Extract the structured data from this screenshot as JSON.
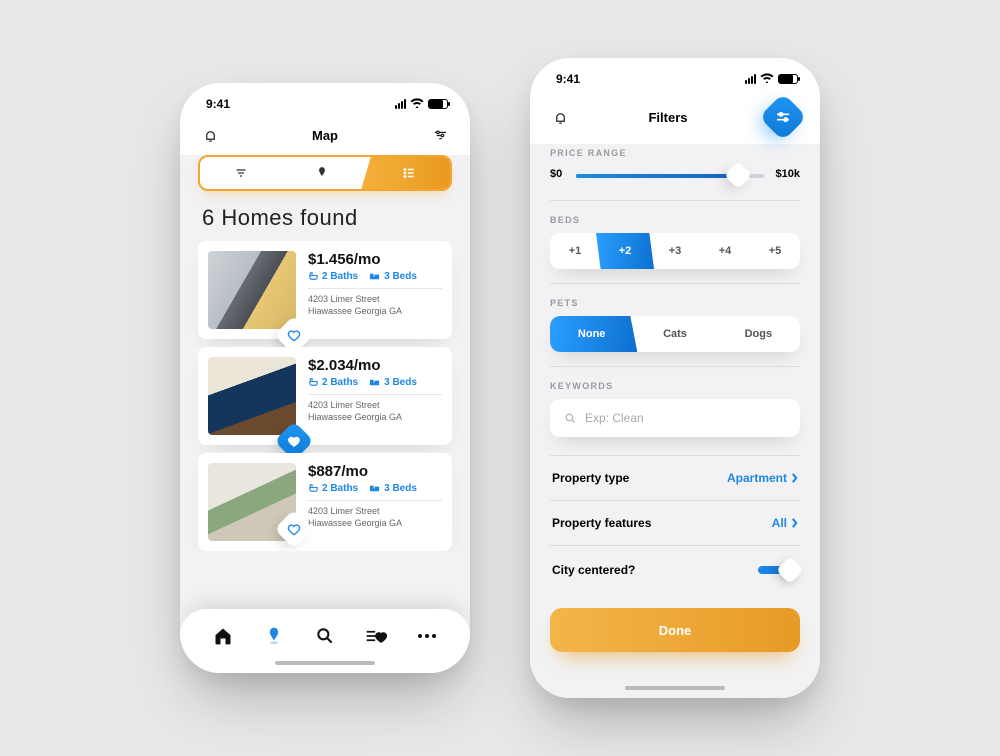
{
  "status": {
    "time": "9:41"
  },
  "map_screen": {
    "title": "Map",
    "results_heading": "6 Homes found",
    "listings": [
      {
        "price": "$1.456/mo",
        "baths": "2 Baths",
        "beds": "3 Beds",
        "address_line1": "4203 Limer Street",
        "address_line2": "Hiawassee Georgia GA",
        "favorited": false
      },
      {
        "price": "$2.034/mo",
        "baths": "2 Baths",
        "beds": "3 Beds",
        "address_line1": "4203 Limer Street",
        "address_line2": "Hiawassee Georgia GA",
        "favorited": true
      },
      {
        "price": "$887/mo",
        "baths": "2 Baths",
        "beds": "3 Beds",
        "address_line1": "4203 Limer Street",
        "address_line2": "Hiawassee Georgia GA",
        "favorited": false
      }
    ]
  },
  "filters_screen": {
    "title": "Filters",
    "sections": {
      "price": {
        "label": "PRICE RANGE",
        "min": "$0",
        "max": "$10k"
      },
      "beds": {
        "label": "BEDS",
        "options": [
          "+1",
          "+2",
          "+3",
          "+4",
          "+5"
        ],
        "selected": "+2"
      },
      "pets": {
        "label": "PETS",
        "options": [
          "None",
          "Cats",
          "Dogs"
        ],
        "selected": "None"
      },
      "keywords": {
        "label": "KEYWORDS",
        "placeholder": "Exp: Clean"
      }
    },
    "rows": {
      "property_type": {
        "label": "Property type",
        "value": "Apartment"
      },
      "property_features": {
        "label": "Property features",
        "value": "All"
      },
      "city_centered": {
        "label": "City centered?",
        "value": true
      }
    },
    "done": "Done"
  },
  "colors": {
    "blue": "#1e88e5",
    "orange": "#ef9f24"
  }
}
